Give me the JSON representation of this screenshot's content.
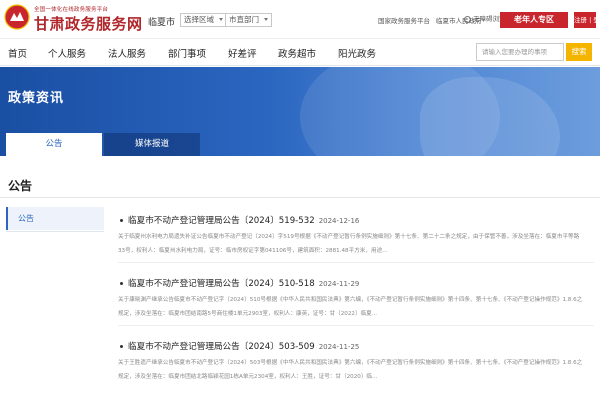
{
  "header": {
    "logo_subtitle": "全国一体化在线政务服务平台",
    "logo_title": "甘肃政务服务网",
    "city": "临夏市",
    "region_select": "选择区域",
    "dept_select": "市直部门",
    "links": [
      "国家政务服务平台",
      "临夏市人民政府"
    ],
    "accessibility": "无障碍浏览",
    "elder_mode": "老年人专区",
    "auth": "注册 | 登录"
  },
  "nav": {
    "items": [
      "首页",
      "个人服务",
      "法人服务",
      "部门事项",
      "好差评",
      "政务超市",
      "阳光政务"
    ],
    "search_placeholder": "请输入您要办理的事项",
    "search_button": "搜索"
  },
  "banner": {
    "title": "政策资讯",
    "tabs": [
      {
        "label": "公告",
        "active": true
      },
      {
        "label": "媒体报道",
        "active": false
      }
    ]
  },
  "section": {
    "title": "公告",
    "sidebar_item": "公告"
  },
  "articles": [
    {
      "title": "临夏市不动产登记管理局公告〔2024〕519-532",
      "date": "2024-12-16",
      "summary": "关于临夏州水利电力局遗失补证公告临夏市不动产登记〔2024〕字519号根据《不动产登记暂行条例实施细则》第十七条、第二十二条之规定，由于保管不善，涉及坐落在：临夏市平等路33号，权利人：临夏州水利电力局，证号：临市房权证字第041106号，建筑面积：2881.48平方米，用途..."
    },
    {
      "title": "临夏市不动产登记管理局公告〔2024〕510-518",
      "date": "2024-11-29",
      "summary": "关于康晓渊产继承公告临夏市不动产登记字〔2024〕510号根据《中华人民共和国民法典》第六编，《不动产登记暂行条例实施细则》第十四条、第十七条、《不动产登记操作规范》1.8.6之规定，涉及坐落在：临夏市团结南路5号商住楼1单元2903室，权利人：康英，证号：甘〔2022〕临夏..."
    },
    {
      "title": "临夏市不动产登记管理局公告〔2024〕503-509",
      "date": "2024-11-25",
      "summary": "关于王胜遗产继承公告临夏市不动产登记字〔2024〕503号根据《中华人民共和国民法典》第六编，《不动产登记暂行条例实施细则》第十四条、第十七条、《不动产登记操作规范》1.8.6之规定，涉及坐落在：临夏市团结北路临颖花园1栋A单元2304室，权利人：王胜，证号：甘〔2020〕临..."
    }
  ]
}
